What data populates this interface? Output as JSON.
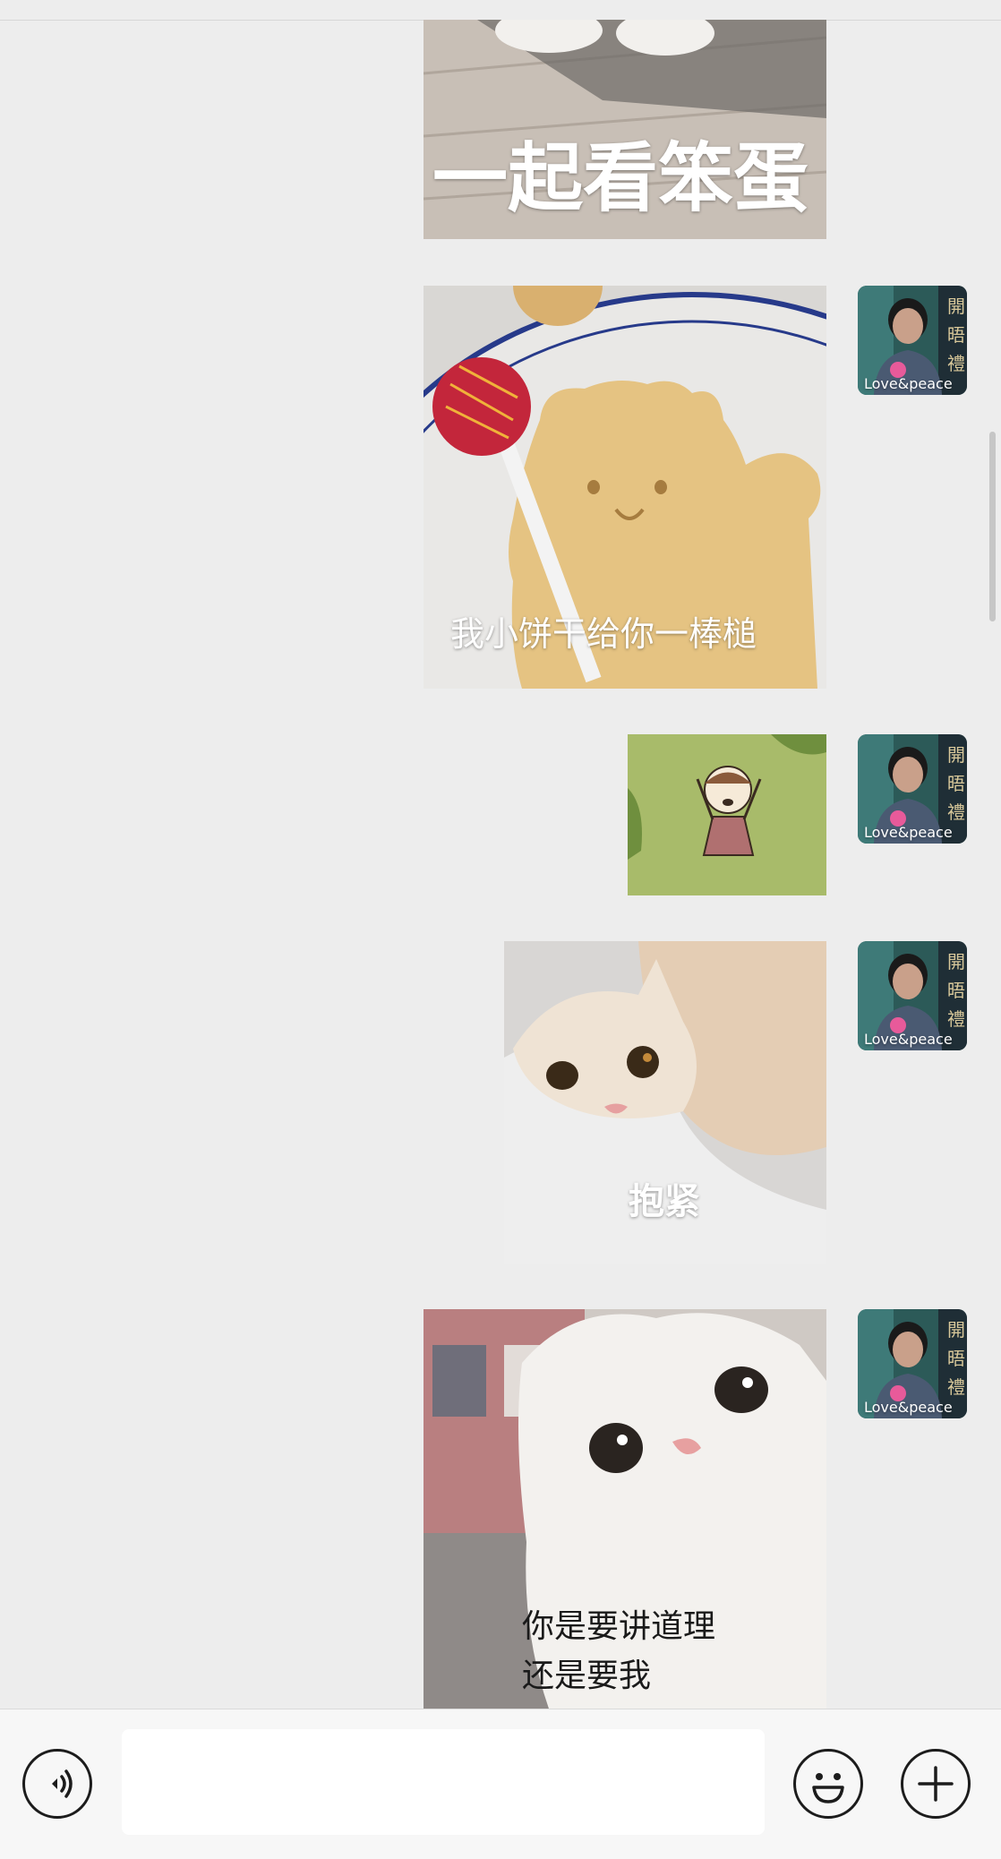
{
  "stickers": [
    {
      "id": "eggs",
      "caption": "一起看笨蛋"
    },
    {
      "id": "cookie",
      "caption": "我小饼干给你一棒槌"
    },
    {
      "id": "cartoon-girl",
      "caption": ""
    },
    {
      "id": "orange-cat",
      "caption": "抱紧"
    },
    {
      "id": "white-cat",
      "caption_line1": "你是要讲道理",
      "caption_line2": "还是要我"
    }
  ],
  "avatar": {
    "text": "Love&peace",
    "sign": "開晤禮"
  },
  "toolbar": {
    "voice_icon": "voice-icon",
    "emoji_icon": "emoji-icon",
    "plus_icon": "plus-icon"
  }
}
